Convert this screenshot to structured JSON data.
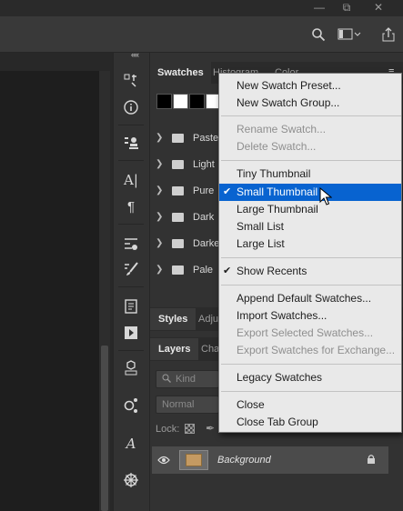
{
  "panel_tabs": {
    "swatches": "Swatches",
    "histogram": "Histogram",
    "color": "Color"
  },
  "swatch_colors": [
    "#000000",
    "#ffffff",
    "#000000",
    "#ffffff"
  ],
  "swatch_groups": [
    "Pastel",
    "Light",
    "Pure",
    "Dark",
    "Darker",
    "Pale"
  ],
  "styles_tabs": {
    "styles": "Styles",
    "adjustments": "Adju"
  },
  "layers_tabs": {
    "layers": "Layers",
    "channels": "Cha"
  },
  "layers": {
    "filter_placeholder": "Kind",
    "blend_mode": "Normal",
    "lock_label": "Lock:",
    "layer_name": "Background"
  },
  "menu": {
    "new_swatch_preset": "New Swatch Preset...",
    "new_swatch_group": "New Swatch Group...",
    "rename_swatch": "Rename Swatch...",
    "delete_swatch": "Delete Swatch...",
    "tiny_thumbnail": "Tiny Thumbnail",
    "small_thumbnail": "Small Thumbnail",
    "large_thumbnail": "Large Thumbnail",
    "small_list": "Small List",
    "large_list": "Large List",
    "show_recents": "Show Recents",
    "append_default": "Append Default Swatches...",
    "import_swatches": "Import Swatches...",
    "export_selected": "Export Selected Swatches...",
    "export_exchange": "Export Swatches for Exchange...",
    "legacy_swatches": "Legacy Swatches",
    "close": "Close",
    "close_tab_group": "Close Tab Group"
  },
  "colors": {
    "menu_highlight": "#0863d0",
    "panel_bg": "#323232",
    "app_bg": "#1f1f1f"
  }
}
